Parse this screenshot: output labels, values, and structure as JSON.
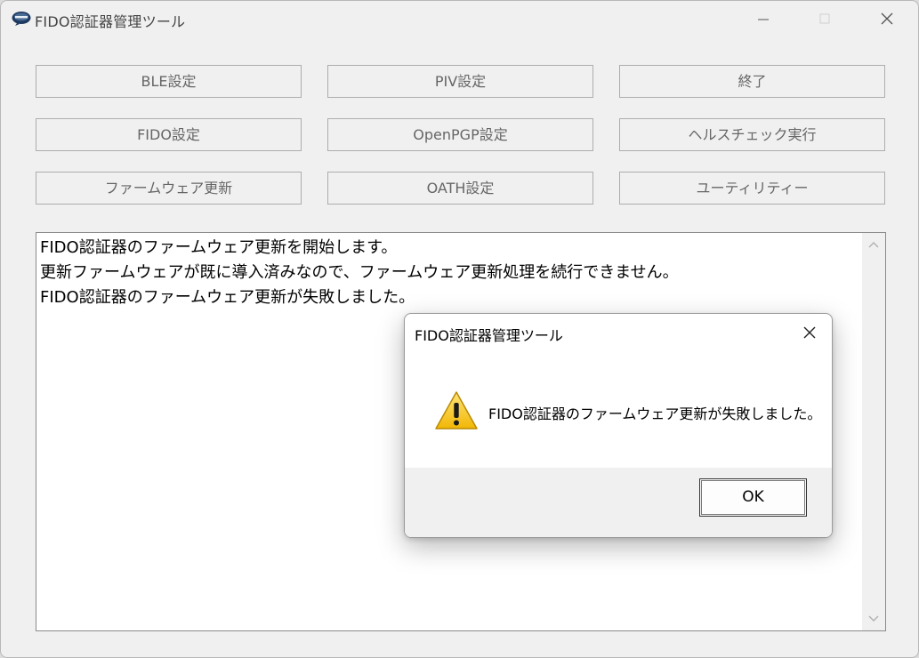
{
  "window": {
    "title": "FIDO認証器管理ツール"
  },
  "buttons": {
    "ble": "BLE設定",
    "piv": "PIV設定",
    "exit": "終了",
    "fido": "FIDO設定",
    "openpgp": "OpenPGP設定",
    "healthcheck": "ヘルスチェック実行",
    "firmware": "ファームウェア更新",
    "oath": "OATH設定",
    "utility": "ユーティリティー"
  },
  "log": {
    "lines": [
      "FIDO認証器のファームウェア更新を開始します。",
      "更新ファームウェアが既に導入済みなので、ファームウェア更新処理を続行できません。",
      "FIDO認証器のファームウェア更新が失敗しました。"
    ]
  },
  "dialog": {
    "title": "FIDO認証器管理ツール",
    "message": "FIDO認証器のファームウェア更新が失敗しました。",
    "ok_label": "OK",
    "icon": "warning-icon"
  },
  "colors": {
    "window_bg": "#f0f0f0",
    "warning_yellow": "#f6c518",
    "button_text": "#666666"
  }
}
